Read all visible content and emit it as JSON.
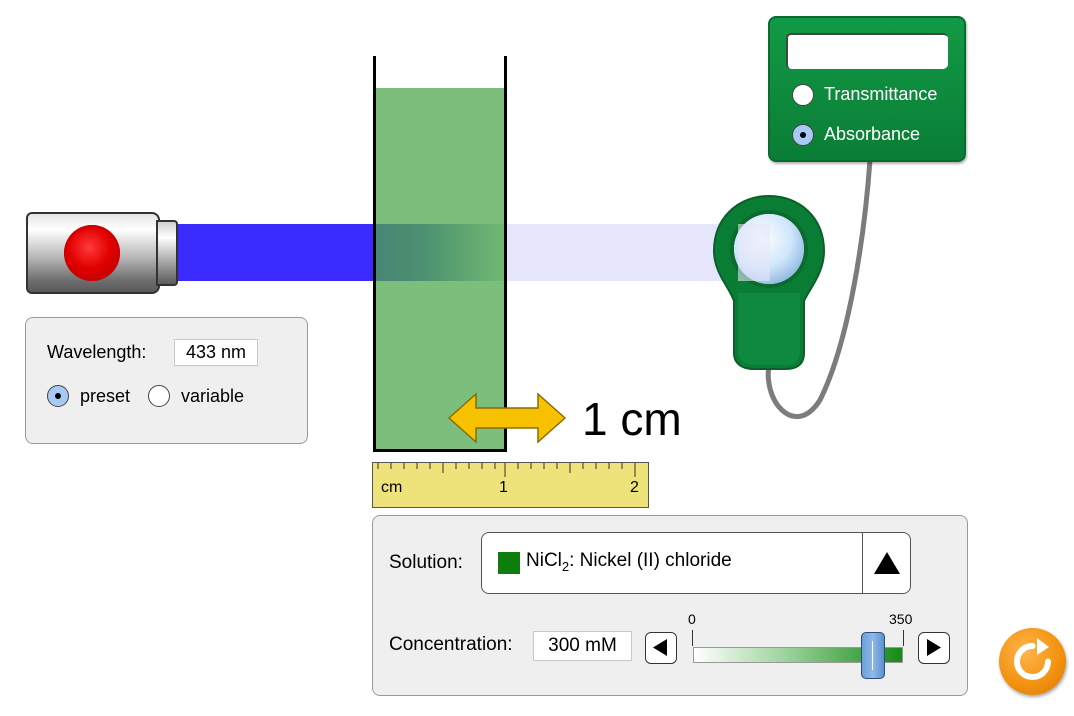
{
  "light": {
    "button_icon": "power-button-icon",
    "beam_color": "#3c2bff",
    "wavelength_label": "Wavelength:",
    "wavelength_value": "433 nm",
    "mode_options": [
      {
        "label": "preset",
        "selected": true
      },
      {
        "label": "variable",
        "selected": false
      }
    ]
  },
  "cuvette": {
    "width_label": "1 cm",
    "solution_color": "#50aa50",
    "arrow_icon": "double-arrow-icon"
  },
  "ruler": {
    "unit": "cm",
    "marks": [
      "1",
      "2"
    ]
  },
  "meter": {
    "reading": "",
    "options": [
      {
        "label": "Transmittance",
        "selected": false
      },
      {
        "label": "Absorbance",
        "selected": true
      }
    ],
    "color": "#0a7d35"
  },
  "solution": {
    "label": "Solution:",
    "selected_name_prefix": "NiCl",
    "selected_name_subscript": "2",
    "selected_name_suffix": ": Nickel (II) chloride",
    "swatch_color": "#0d7d0d",
    "dropdown_icon": "triangle-up-icon"
  },
  "concentration": {
    "label": "Concentration:",
    "value_text": "300 mM",
    "slider_min": "0",
    "slider_max": "350",
    "slider_value": 300,
    "decrement_icon": "triangle-left-icon",
    "increment_icon": "triangle-right-icon"
  },
  "reset": {
    "icon": "reset-icon",
    "color": "#f39311"
  }
}
